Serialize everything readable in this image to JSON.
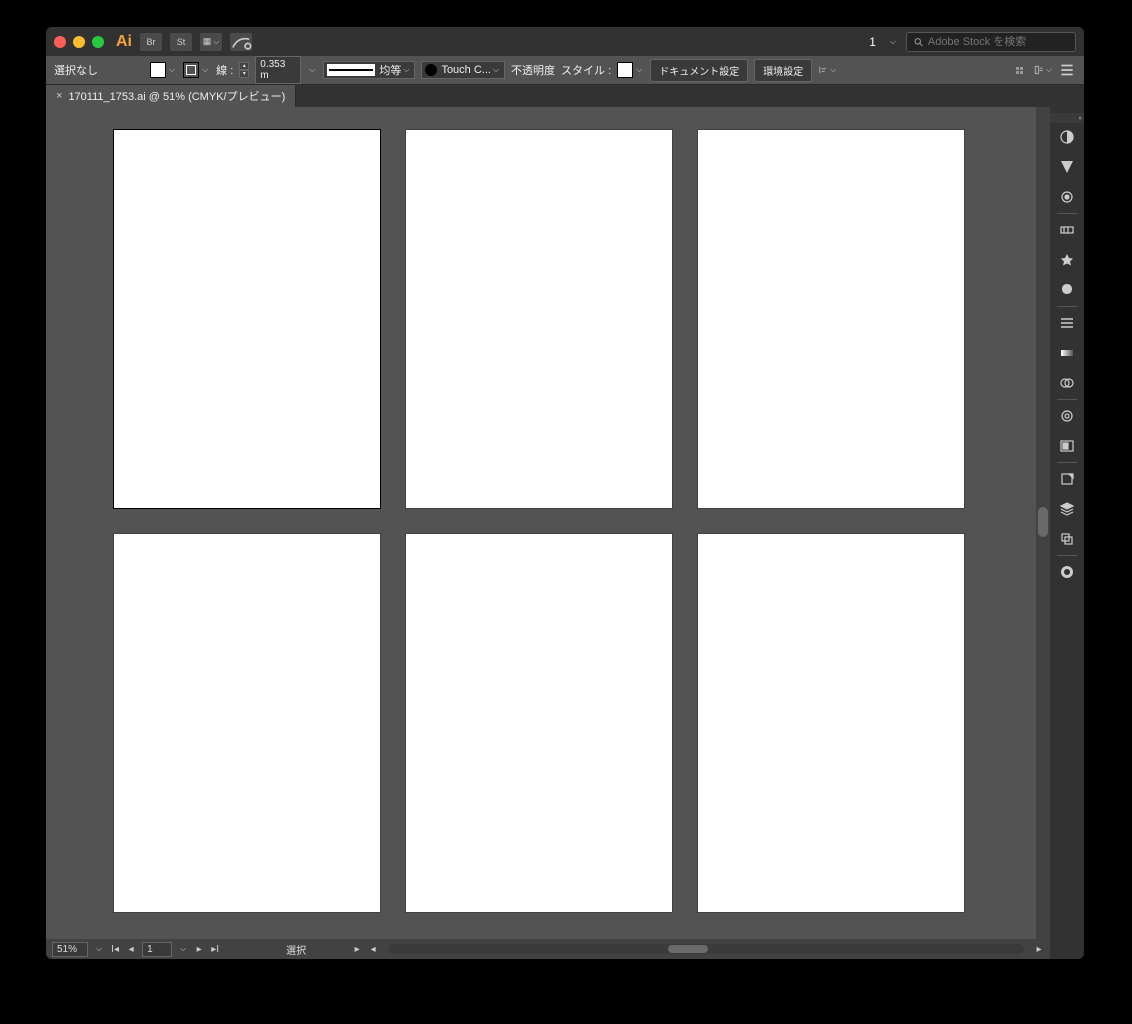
{
  "titlebar": {
    "workspace_num": "1",
    "search_placeholder": "Adobe Stock を検索"
  },
  "optbar": {
    "selection": "選択なし",
    "stroke_label": "線 :",
    "stroke_value": "0.353 m",
    "stroke_style": "均等",
    "profile": "Touch C...",
    "opacity_label": "不透明度",
    "style_label": "スタイル :",
    "doc_setup": "ドキュメント設定",
    "preferences": "環境設定"
  },
  "tab": {
    "filename": "170111_1753.ai @ 51% (CMYK/プレビュー)"
  },
  "status": {
    "zoom": "51%",
    "artboard": "1",
    "tool": "選択"
  }
}
